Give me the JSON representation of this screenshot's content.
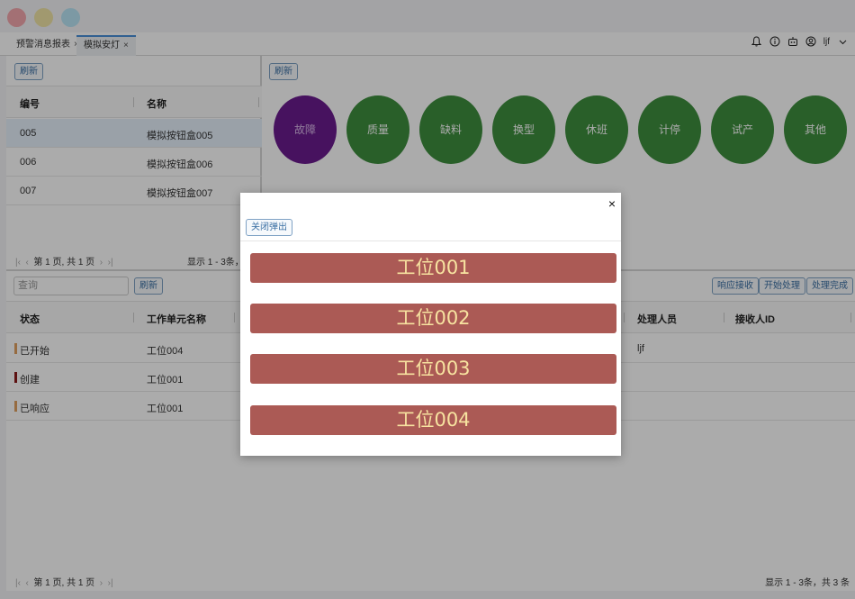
{
  "tabs": [
    {
      "label": "预警消息报表",
      "close": "×"
    },
    {
      "label": "模拟安灯",
      "close": "×"
    }
  ],
  "header": {
    "user": "ljf"
  },
  "top_left": {
    "refresh": "刷新",
    "columns": [
      "编号",
      "名称"
    ],
    "rows": [
      {
        "id": "005",
        "name": "模拟按钮盒005"
      },
      {
        "id": "006",
        "name": "模拟按钮盒006"
      },
      {
        "id": "007",
        "name": "模拟按钮盒007"
      }
    ],
    "pager_page": "第 1 页, 共 1 页",
    "pager_info": "显示 1 - 3条，共"
  },
  "top_right": {
    "refresh": "刷新",
    "categories": [
      "故障",
      "质量",
      "缺料",
      "换型",
      "休班",
      "计停",
      "试产",
      "其他"
    ]
  },
  "bottom": {
    "search_placeholder": "查询",
    "refresh": "刷新",
    "actions": [
      "响应接收",
      "开始处理",
      "处理完成"
    ],
    "columns": [
      "状态",
      "工作单元名称",
      "处理人员",
      "接收人ID"
    ],
    "rows": [
      {
        "status": "已开始",
        "status_color": "#e0a060",
        "unit": "工位004",
        "handler": "ljf"
      },
      {
        "status": "创建",
        "status_color": "#8b1a1a",
        "unit": "工位001",
        "handler": ""
      },
      {
        "status": "已响应",
        "status_color": "#e0a060",
        "unit": "工位001",
        "handler": ""
      }
    ],
    "pager_page": "第 1 页, 共 1 页",
    "pager_info": "显示 1 - 3条，共 3 条"
  },
  "modal": {
    "close_button": "关闭弹出",
    "close_icon": "×",
    "stations": [
      "工位001",
      "工位002",
      "工位003",
      "工位004"
    ]
  },
  "colors": {
    "accent": "#4a90d9",
    "fault": "#6b1c8e",
    "category": "#3e8e3e",
    "station": "#ab5a55"
  }
}
